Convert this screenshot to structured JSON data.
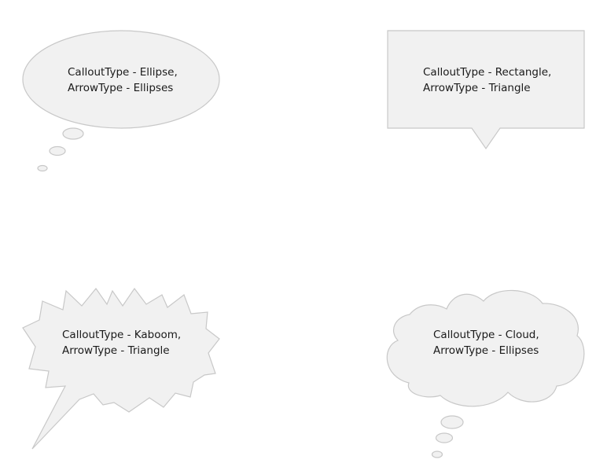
{
  "callouts": [
    {
      "line1": "CalloutType - Ellipse,",
      "line2": "ArrowType - Ellipses",
      "callout_type": "Ellipse",
      "arrow_type": "Ellipses"
    },
    {
      "line1": "CalloutType - Rectangle,",
      "line2": "ArrowType - Triangle",
      "callout_type": "Rectangle",
      "arrow_type": "Triangle"
    },
    {
      "line1": "CalloutType - Kaboom,",
      "line2": "ArrowType - Triangle",
      "callout_type": "Kaboom",
      "arrow_type": "Triangle"
    },
    {
      "line1": "CalloutType - Cloud,",
      "line2": "ArrowType - Ellipses",
      "callout_type": "Cloud",
      "arrow_type": "Ellipses"
    }
  ],
  "colors": {
    "fill": "#f1f1f1",
    "stroke": "#c8c8c8",
    "text": "#1a1a1a",
    "background": "#ffffff"
  }
}
